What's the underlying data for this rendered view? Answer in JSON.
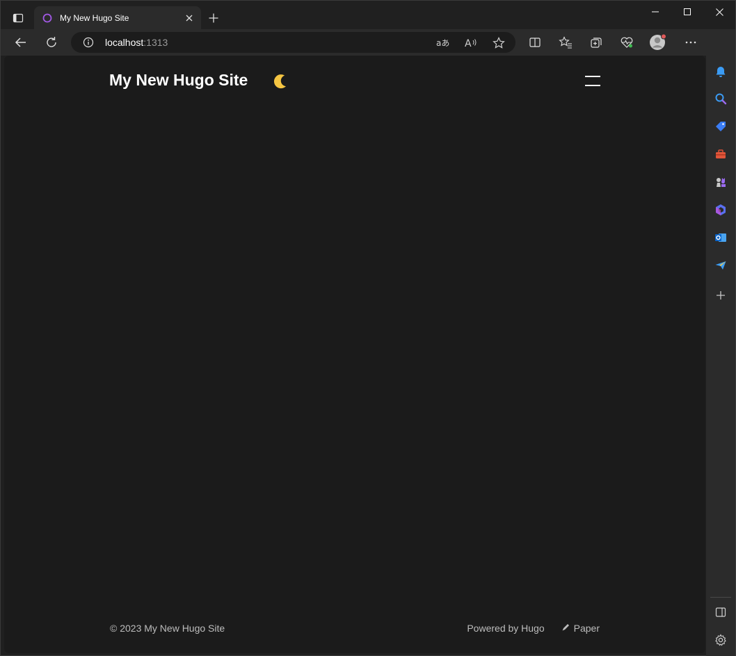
{
  "browser": {
    "tab": {
      "title": "My New Hugo Site"
    },
    "address": {
      "host": "localhost",
      "port": ":1313"
    }
  },
  "page": {
    "site_title": "My New Hugo Site",
    "theme_toggle_glyph": "🌙",
    "footer": {
      "copyright": "© 2023 My New Hugo Site",
      "powered_by": "Powered by Hugo",
      "theme_link": "Paper"
    }
  },
  "colors": {
    "chrome_bg": "#202020",
    "toolbar_bg": "#2b2b2b",
    "page_bg": "#1b1b1b",
    "accent_purple": "#a259e6",
    "moon": "#f5c542"
  },
  "icons": {
    "tab_actions": "tab-actions-icon",
    "favicon": "hugo-ring-icon",
    "close": "close-icon",
    "new_tab": "plus-icon",
    "minimize": "minimize-icon",
    "maximize": "maximize-icon",
    "back": "back-arrow-icon",
    "refresh": "refresh-icon",
    "info": "info-icon",
    "translate": "translate-icon",
    "read_aloud": "read-aloud-icon",
    "favorite": "star-icon",
    "split_screen": "split-screen-icon",
    "favorites": "favorites-icon",
    "collections": "collections-icon",
    "performance": "heart-pulse-icon",
    "profile": "profile-icon",
    "more": "more-icon",
    "copilot": "copilot-icon",
    "bell": "bell-icon",
    "search": "search-icon",
    "shopping": "tag-icon",
    "tools": "toolbox-icon",
    "games": "chess-icon",
    "office": "office-icon",
    "outlook": "outlook-icon",
    "drop": "drop-icon",
    "add": "plus-icon",
    "sidebar_toggle": "sidebar-icon",
    "settings": "gear-icon"
  }
}
